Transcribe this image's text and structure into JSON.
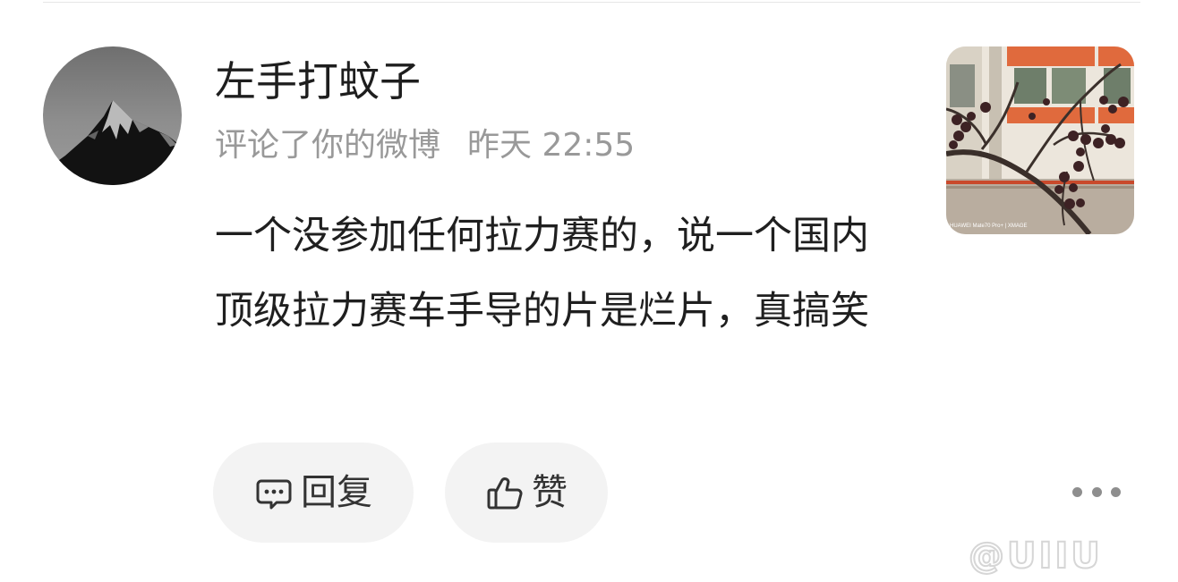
{
  "notification": {
    "username": "左手打蚊子",
    "action_text": "评论了你的微博",
    "timestamp": "昨天 22:55",
    "comment_text": "一个没参加任何拉力赛的，说一个国内顶级拉力赛车手导的片是烂片，真搞笑",
    "thumbnail_caption": "HUAWEI Mate70 Pro+ | XMAGE"
  },
  "actions": {
    "reply_label": "回复",
    "like_label": "赞",
    "reply_icon": "comment-bubble-icon",
    "like_icon": "thumbs-up-icon",
    "more_icon": "more-dots-icon"
  },
  "watermark": {
    "text": "@UIIU"
  },
  "colors": {
    "username": "#1e1e1e",
    "meta_gray": "#999999",
    "button_bg": "#f3f3f3",
    "divider": "#e6e6e6"
  }
}
